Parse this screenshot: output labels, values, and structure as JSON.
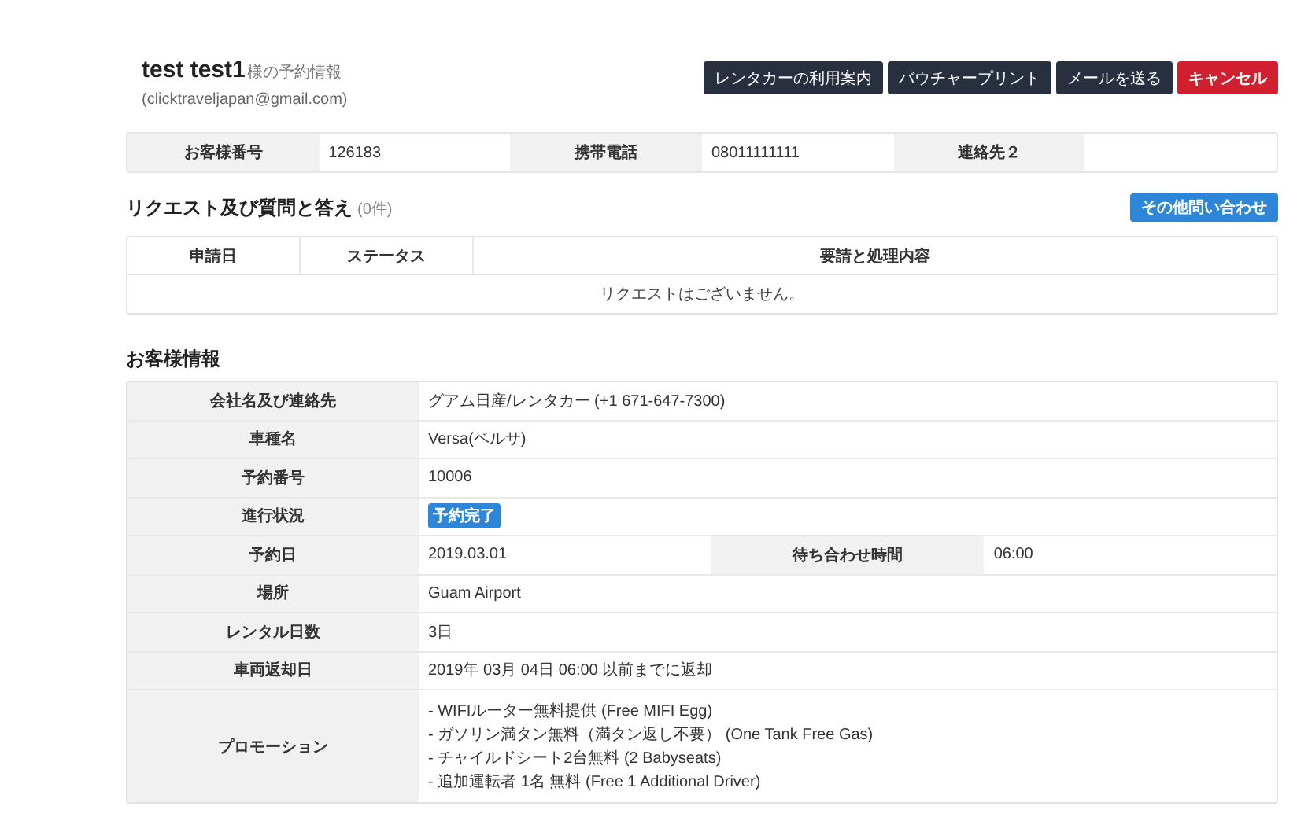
{
  "header": {
    "name": "test test1",
    "suffix": "様の予約情報",
    "email": "(clicktraveljapan@gmail.com)"
  },
  "actions": [
    {
      "label": "レンタカーの利用案内",
      "kind": "dark"
    },
    {
      "label": "バウチャープリント",
      "kind": "dark"
    },
    {
      "label": "メールを送る",
      "kind": "dark"
    },
    {
      "label": "キャンセル",
      "kind": "danger"
    }
  ],
  "contact": [
    {
      "label": "お客様番号",
      "value": "126183"
    },
    {
      "label": "携帯電話",
      "value": "08011111111"
    },
    {
      "label": "連絡先２"
    }
  ],
  "requests": {
    "title": "リクエスト及び質問と答え",
    "count": "(0件)",
    "button": "その他問い合わせ",
    "columns": [
      "申請日",
      "ステータス",
      "要請と処理内容"
    ],
    "empty": "リクエストはございません。"
  },
  "customer": {
    "title": "お客様情報",
    "rows": [
      {
        "label": "会社名及び連絡先",
        "kind": "text",
        "value": "グアム日産/レンタカー (+1 671-647-7300)"
      },
      {
        "label": "車種名",
        "kind": "text",
        "value": "Versa(ベルサ)"
      },
      {
        "label": "予約番号",
        "kind": "text",
        "value": "10006"
      },
      {
        "label": "進行状況",
        "kind": "badge",
        "value": "予約完了"
      },
      {
        "label": "予約日",
        "kind": "pair",
        "value": "2019.03.01",
        "label2": "待ち合わせ時間",
        "value2": "06:00"
      },
      {
        "label": "場所",
        "kind": "text",
        "value": "Guam Airport"
      },
      {
        "label": "レンタル日数",
        "kind": "text",
        "value": "3日"
      },
      {
        "label": "車両返却日",
        "kind": "text",
        "value": "2019年 03月 04日 06:00 以前までに返却"
      },
      {
        "label": "プロモーション",
        "kind": "lines",
        "lines": [
          "- WIFIルーター無料提供 (Free MIFI Egg)",
          "- ガソリン満タン無料（満タン返し不要） (One Tank Free Gas)",
          "- チャイルドシート2台無料 (2 Babyseats)",
          "- 追加運転者 1名 無料 (Free 1 Additional Driver)"
        ]
      }
    ]
  }
}
